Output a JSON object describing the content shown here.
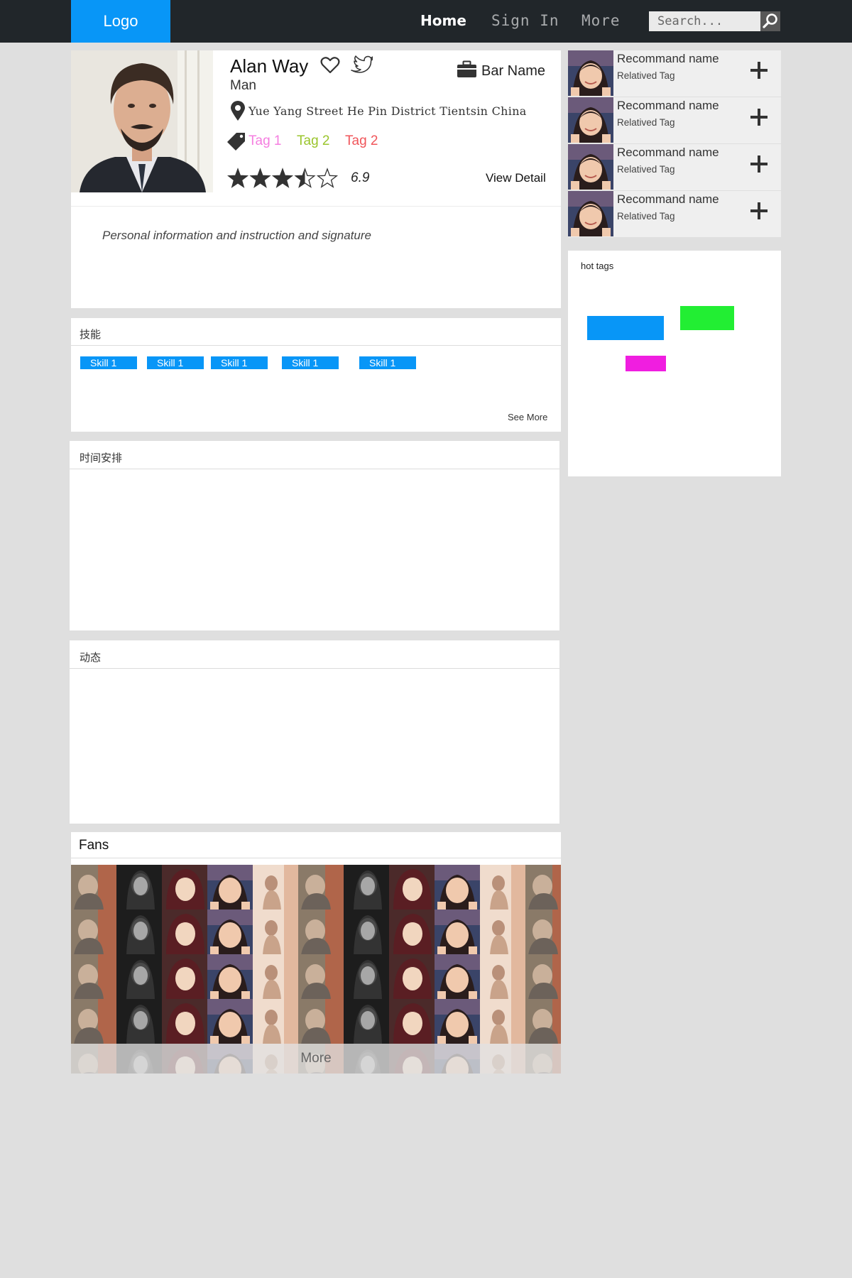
{
  "nav": {
    "logo": "Logo",
    "links": [
      "Home",
      "Sign In",
      "More"
    ],
    "search_placeholder": "Search..."
  },
  "profile": {
    "name": "Alan Way",
    "gender": "Man",
    "bar_name": "Bar Name",
    "address": "Yue Yang Street He Pin District Tientsin China",
    "tags": [
      {
        "label": "Tag 1",
        "color": "#f57ee0"
      },
      {
        "label": "Tag 2",
        "color": "#9ac52c"
      },
      {
        "label": "Tag 2",
        "color": "#f0555a"
      }
    ],
    "rating": 3.5,
    "rating_max": 5,
    "score": "6.9",
    "view_detail": "View Detail",
    "signature": "Personal information and instruction and signature"
  },
  "skills": {
    "title": "技能",
    "items": [
      "Skill 1",
      "Skill 1",
      "Skill 1",
      "Skill 1",
      "Skill 1"
    ],
    "see_more": "See More"
  },
  "schedule": {
    "title": "时间安排"
  },
  "activity": {
    "title": "动态"
  },
  "fans": {
    "title": "Fans",
    "more": "More"
  },
  "recommend": {
    "items": [
      {
        "name": "Recommand name",
        "tag": "Relatived Tag"
      },
      {
        "name": "Recommand name",
        "tag": "Relatived Tag"
      },
      {
        "name": "Recommand name",
        "tag": "Relatived Tag"
      },
      {
        "name": "Recommand name",
        "tag": "Relatived Tag"
      }
    ]
  },
  "hot_tags": {
    "title": "hot tags",
    "colors": [
      "#0896f7",
      "#22ee33",
      "#f01ee0"
    ]
  },
  "colors": {
    "accent": "#0896f7",
    "topbar": "#21262a"
  }
}
